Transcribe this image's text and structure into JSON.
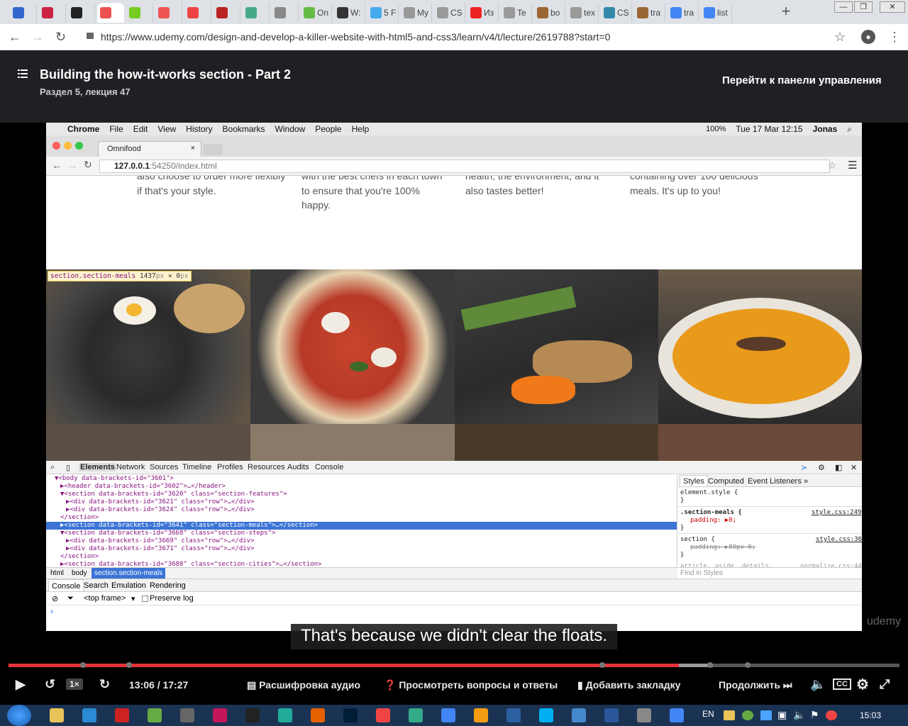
{
  "browser": {
    "tabs": [
      {
        "label": "",
        "color": "#36c"
      },
      {
        "label": "",
        "color": "#c24"
      },
      {
        "label": "",
        "color": "#222"
      },
      {
        "label": "",
        "color": "#ec5252"
      },
      {
        "label": "",
        "color": "#7c2"
      },
      {
        "label": "",
        "color": "#e55"
      },
      {
        "label": "",
        "color": "#e44"
      },
      {
        "label": "",
        "color": "#b22"
      },
      {
        "label": "",
        "color": "#4a8"
      },
      {
        "label": "",
        "color": "#888"
      },
      {
        "label": "On",
        "color": "#6b4"
      },
      {
        "label": "W:",
        "color": "#333"
      },
      {
        "label": "5 F",
        "color": "#4ae"
      },
      {
        "label": "My",
        "color": "#999"
      },
      {
        "label": "CS",
        "color": "#999"
      },
      {
        "label": "Из",
        "color": "#e22"
      },
      {
        "label": "Te",
        "color": "#999"
      },
      {
        "label": "bo",
        "color": "#963"
      },
      {
        "label": "tex",
        "color": "#999"
      },
      {
        "label": "CS",
        "color": "#38a"
      },
      {
        "label": "tra",
        "color": "#963"
      },
      {
        "label": "tra",
        "color": "#4285f4"
      },
      {
        "label": "list",
        "color": "#4285f4"
      }
    ],
    "url": "https://www.udemy.com/design-and-develop-a-killer-website-with-html5-and-css3/learn/v4/t/lecture/2619788?start=0",
    "win_min": "—",
    "win_max": "❐",
    "win_close": "✕"
  },
  "udemy": {
    "lecture_title": "Building the how-it-works section - Part 2",
    "lecture_sub": "Раздел 5, лекция 47",
    "dashboard_link": "Перейти к панели управления"
  },
  "mac": {
    "menu": [
      "Chrome",
      "File",
      "Edit",
      "View",
      "History",
      "Bookmarks",
      "Window",
      "People",
      "Help"
    ],
    "battery": "100%",
    "datetime": "Tue 17 Mar  12:15",
    "user": "Jonas"
  },
  "inner_browser": {
    "tab_title": "Omnifood",
    "url_host": "127.0.0.1",
    "url_rest": ":54250/index.html"
  },
  "features": [
    {
      "text": "also choose to order more flexibly if that's your style."
    },
    {
      "text": "with the best chefs in each town to ensure that you're 100% happy."
    },
    {
      "text": "health, the environment, and it also tastes better!"
    },
    {
      "text": "containing over 100 delicious meals. It's up to you!"
    }
  ],
  "inspect_tooltip": {
    "selector": "section.section-meals",
    "size_w": "1437",
    "size_h": "0",
    "unit": "px",
    "times": "×"
  },
  "devtools": {
    "tabs": [
      "Elements",
      "Network",
      "Sources",
      "Timeline",
      "Profiles",
      "Resources",
      "Audits",
      "Console"
    ],
    "rows": [
      {
        "text": "▼<body data-brackets-id=\"3601\">"
      },
      {
        "text": "  ▶<header data-brackets-id=\"3602\">…</header>"
      },
      {
        "text": "  ▼<section data-brackets-id=\"3620\" class=\"section-features\">"
      },
      {
        "text": "    ▶<div data-brackets-id=\"3621\" class=\"row\">…</div>"
      },
      {
        "text": "    ▶<div data-brackets-id=\"3624\" class=\"row\">…</div>"
      },
      {
        "text": "    </section>"
      },
      {
        "text": "  ▶<section data-brackets-id=\"3641\" class=\"section-meals\">…</section>"
      },
      {
        "text": "  ▼<section data-brackets-id=\"3668\" class=\"section-steps\">"
      },
      {
        "text": "    ▶<div data-brackets-id=\"3669\" class=\"row\">…</div>"
      },
      {
        "text": "    ▶<div data-brackets-id=\"3671\" class=\"row\">…</div>"
      },
      {
        "text": "    </section>"
      },
      {
        "text": "  ▶<section data-brackets-id=\"3688\" class=\"section-cities\">…</section>"
      }
    ],
    "crumbs": [
      "html",
      "body",
      "section.section-meals"
    ],
    "styles_tabs": [
      "Styles",
      "Computed",
      "Event Listeners",
      "»"
    ],
    "element_style": "element.style {",
    "rule1_sel": ".section-meals {",
    "rule1_src": "style.css:249",
    "rule1_prop": "padding: ▶0;",
    "rule2_sel": "section {",
    "rule2_src": "style.css:36",
    "rule2_prop": "padding: ▶80px 0;",
    "rule3_sel": "article, aside, details,",
    "rule3_src": "normalize.css:44",
    "close_brace": "}",
    "find_placeholder": "Find in Styles",
    "drawer_tabs": [
      "Console",
      "Search",
      "Emulation",
      "Rendering"
    ],
    "frame": "<top frame>",
    "preserve_log": "Preserve log",
    "prompt": "›"
  },
  "player": {
    "subtitle": "That's because we didn't clear the floats.",
    "watermark": "udemy",
    "speed": "1×",
    "time": "13:06 / 17:27",
    "progress": 0.7523,
    "buffered_to": 0.8,
    "controls": [
      "Расшифровка аудио",
      "Просмотреть вопросы и ответы",
      "Добавить закладку",
      "Продолжить"
    ],
    "cc": "CC"
  },
  "taskbar": {
    "lang": "EN",
    "clock": "15:03"
  }
}
